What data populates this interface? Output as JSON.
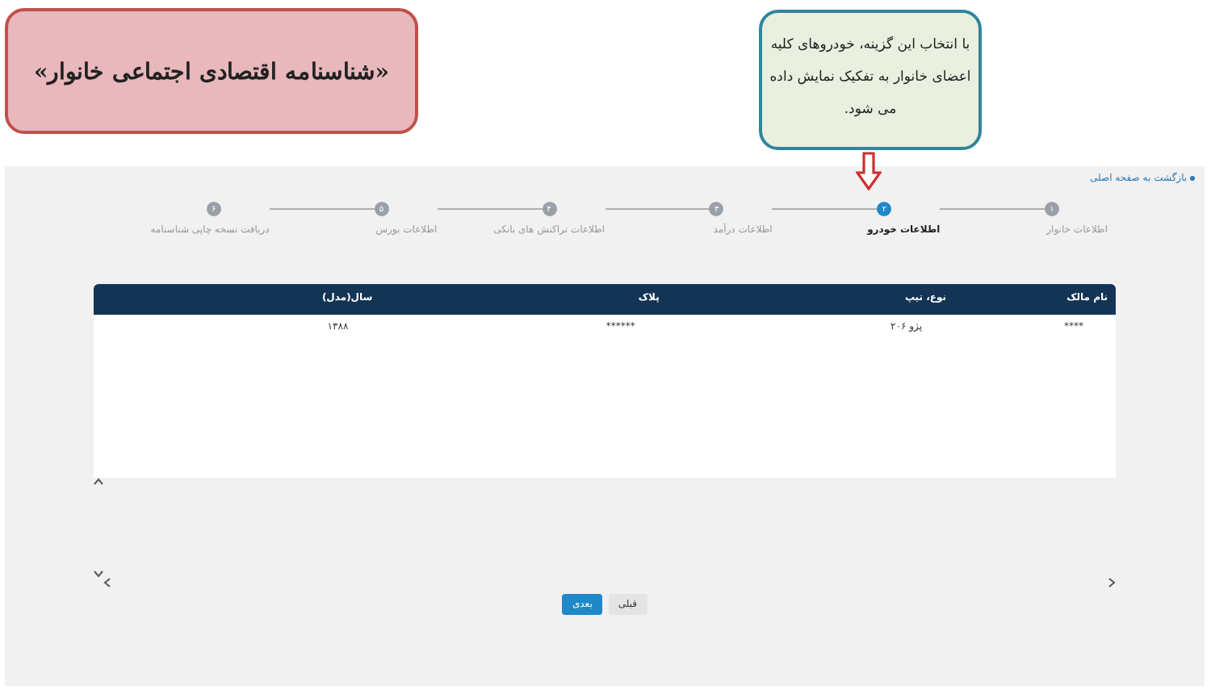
{
  "annotation_title": "«شناسنامه اقتصادی اجتماعی خانوار»",
  "annotation_note": "با انتخاب این گزینه، خودروهای کلیه اعضای خانوار  به تفکیک نمایش داده می شود.",
  "back_link": "بازگشت به صفحه اصلی",
  "steps": [
    {
      "number": "۱",
      "label": "اطلاعات خانوار",
      "selected": false
    },
    {
      "number": "۲",
      "label": "اطلاعات خودرو",
      "selected": true
    },
    {
      "number": "۳",
      "label": "اطلاعات درآمد",
      "selected": false
    },
    {
      "number": "۴",
      "label": "اطلاعات تراکنش های بانکی",
      "selected": false
    },
    {
      "number": "۵",
      "label": "اطلاعات بورس",
      "selected": false
    },
    {
      "number": "۶",
      "label": "دریافت نسخه چاپی شناسنامه",
      "selected": false
    }
  ],
  "table": {
    "columns": [
      "نام مالک",
      "نوع، تیپ",
      "پلاک",
      "سال(مدل)"
    ],
    "rows": [
      [
        "****",
        "پژو ۲۰۶",
        "******",
        "۱۳۸۸"
      ]
    ]
  },
  "buttons": [
    {
      "label": "قبلی",
      "kind": "secondary"
    },
    {
      "label": "بعدی",
      "kind": "primary"
    }
  ]
}
